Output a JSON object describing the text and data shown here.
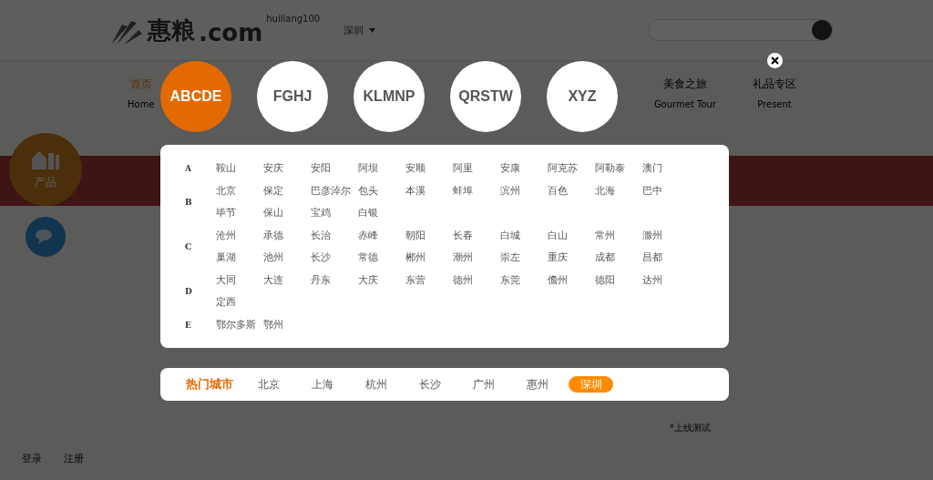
{
  "header": {
    "logo_text": "惠粮",
    "logo_domain": ".com",
    "logo_sub": "huiliang100",
    "location": "深圳"
  },
  "nav": [
    {
      "label": "首页",
      "sub": "Home",
      "selected": true
    },
    {
      "label": "美食之旅",
      "sub": "Gourmet Tour",
      "selected": false
    },
    {
      "label": "礼品专区",
      "sub": "Present",
      "selected": false
    }
  ],
  "side": {
    "product_badge": "产品"
  },
  "footer_links": [
    "登录",
    "注册"
  ],
  "note": "*上线测试",
  "letter_tabs": [
    {
      "label": "ABCDE",
      "selected": true
    },
    {
      "label": "FGHJ",
      "selected": false
    },
    {
      "label": "KLMNP",
      "selected": false
    },
    {
      "label": "QRSTW",
      "selected": false
    },
    {
      "label": "XYZ",
      "selected": false
    }
  ],
  "groups": [
    {
      "letter": "A",
      "cities": [
        "鞍山",
        "安庆",
        "安阳",
        "阿坝",
        "安顺",
        "阿里",
        "安康",
        "阿克苏",
        "阿勒泰",
        "澳门"
      ]
    },
    {
      "letter": "B",
      "cities": [
        "北京",
        "保定",
        "巴彦淖尔",
        "包头",
        "本溪",
        "蚌埠",
        "滨州",
        "百色",
        "北海",
        "巴中",
        "毕节",
        "保山",
        "宝鸡",
        "白银"
      ]
    },
    {
      "letter": "C",
      "cities": [
        "沧州",
        "承德",
        "长治",
        "赤峰",
        "朝阳",
        "长春",
        "白城",
        "白山",
        "常州",
        "滁州",
        "巢湖",
        "池州",
        "长沙",
        "常德",
        "郴州",
        "潮州",
        "崇左",
        "重庆",
        "成都",
        "昌都"
      ]
    },
    {
      "letter": "D",
      "cities": [
        "大同",
        "大连",
        "丹东",
        "大庆",
        "东营",
        "德州",
        "东莞",
        "儋州",
        "德阳",
        "达州",
        "定西"
      ]
    },
    {
      "letter": "E",
      "cities": [
        "鄂尔多斯",
        "鄂州"
      ]
    }
  ],
  "hot": {
    "label": "热门城市",
    "cities": [
      {
        "name": "北京",
        "selected": false
      },
      {
        "name": "上海",
        "selected": false
      },
      {
        "name": "杭州",
        "selected": false
      },
      {
        "name": "长沙",
        "selected": false
      },
      {
        "name": "广州",
        "selected": false
      },
      {
        "name": "惠州",
        "selected": false
      },
      {
        "name": "深圳",
        "selected": true
      }
    ]
  }
}
